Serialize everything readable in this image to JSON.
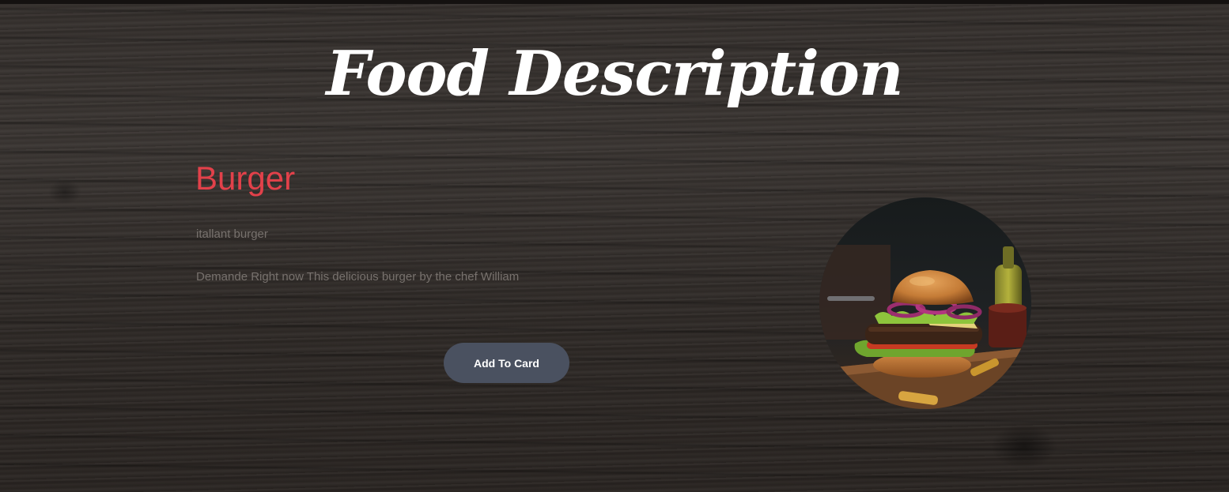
{
  "page": {
    "title": "Food Description"
  },
  "food": {
    "name": "Burger",
    "subtitle": "itallant burger",
    "description": "Demande Right now This delicious burger by the chef William",
    "image_icon": "burger-photo"
  },
  "actions": {
    "add_to_card_label": "Add To Card"
  },
  "colors": {
    "accent": "#e2414a",
    "button_bg": "#4a5160",
    "muted_text": "#77716d",
    "title_text": "#ffffff"
  }
}
